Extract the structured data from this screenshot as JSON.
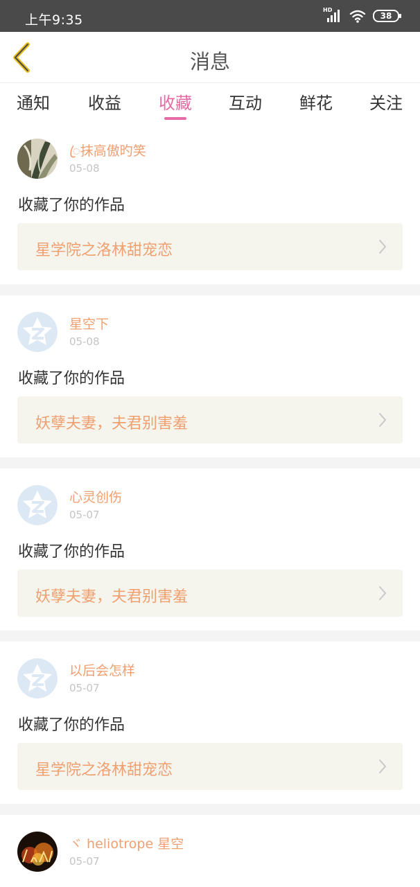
{
  "status_bar": {
    "time": "上午9:35",
    "network_label": "HD",
    "battery": "38"
  },
  "nav": {
    "title": "消息",
    "back_icon": "chevron-left-icon"
  },
  "tabs": [
    {
      "label": "通知",
      "active": false
    },
    {
      "label": "收益",
      "active": false
    },
    {
      "label": "收藏",
      "active": true
    },
    {
      "label": "互动",
      "active": false
    },
    {
      "label": "鲜花",
      "active": false
    },
    {
      "label": "关注",
      "active": false
    }
  ],
  "colors": {
    "accent": "#e86aa4",
    "username": "#f0a070",
    "card_bg": "#f5f5ee"
  },
  "notifications": [
    {
      "username": "ꦿ抹高傲旳笑",
      "date": "05-08",
      "action": "收藏了你的作品",
      "work_title": "星学院之洛林甜宠恋",
      "avatar": "photo-plant"
    },
    {
      "username": "星空下",
      "date": "05-08",
      "action": "收藏了你的作品",
      "work_title": "妖孽夫妻，夫君别害羞",
      "avatar": "default-star"
    },
    {
      "username": "心灵创伤",
      "date": "05-07",
      "action": "收藏了你的作品",
      "work_title": "妖孽夫妻，夫君别害羞",
      "avatar": "default-star"
    },
    {
      "username": "以后会怎样",
      "date": "05-07",
      "action": "收藏了你的作品",
      "work_title": "星学院之洛林甜宠恋",
      "avatar": "default-star"
    },
    {
      "username": "ヾ heliotrope 星空",
      "date": "05-07",
      "action": "收藏了你的作品",
      "work_title": "",
      "avatar": "photo-love"
    }
  ]
}
